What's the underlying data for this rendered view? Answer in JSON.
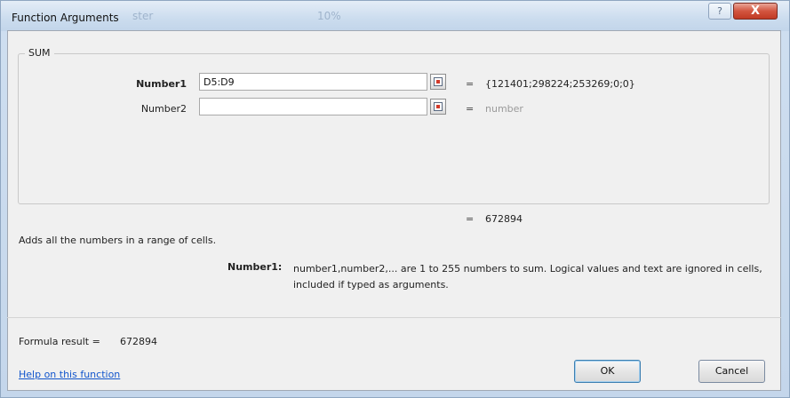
{
  "window": {
    "title": "Function Arguments",
    "ghost_text_1": "ster",
    "ghost_text_2": "10%",
    "help_glyph": "?",
    "close_glyph": "X"
  },
  "function": {
    "name": "SUM",
    "arguments": [
      {
        "label": "Number1",
        "value": "D5:D9",
        "equals": "=",
        "evaluated": "{121401;298224;253269;0;0}"
      },
      {
        "label": "Number2",
        "value": "",
        "equals": "=",
        "evaluated": "number"
      }
    ],
    "result_equals": "=",
    "result_value": "672894",
    "description": "Adds all the numbers in a range of cells.",
    "arg_help_name": "Number1:",
    "arg_help_text": "number1,number2,... are 1 to 255 numbers to sum. Logical values and text are ignored in cells, included if typed as arguments."
  },
  "footer": {
    "formula_result_label": "Formula result =",
    "formula_result_value": "672894",
    "help_link": "Help on this function",
    "ok_label": "OK",
    "cancel_label": "Cancel"
  },
  "icons": {
    "collapse": "range-select-icon",
    "help": "help-icon",
    "close": "close-icon"
  }
}
